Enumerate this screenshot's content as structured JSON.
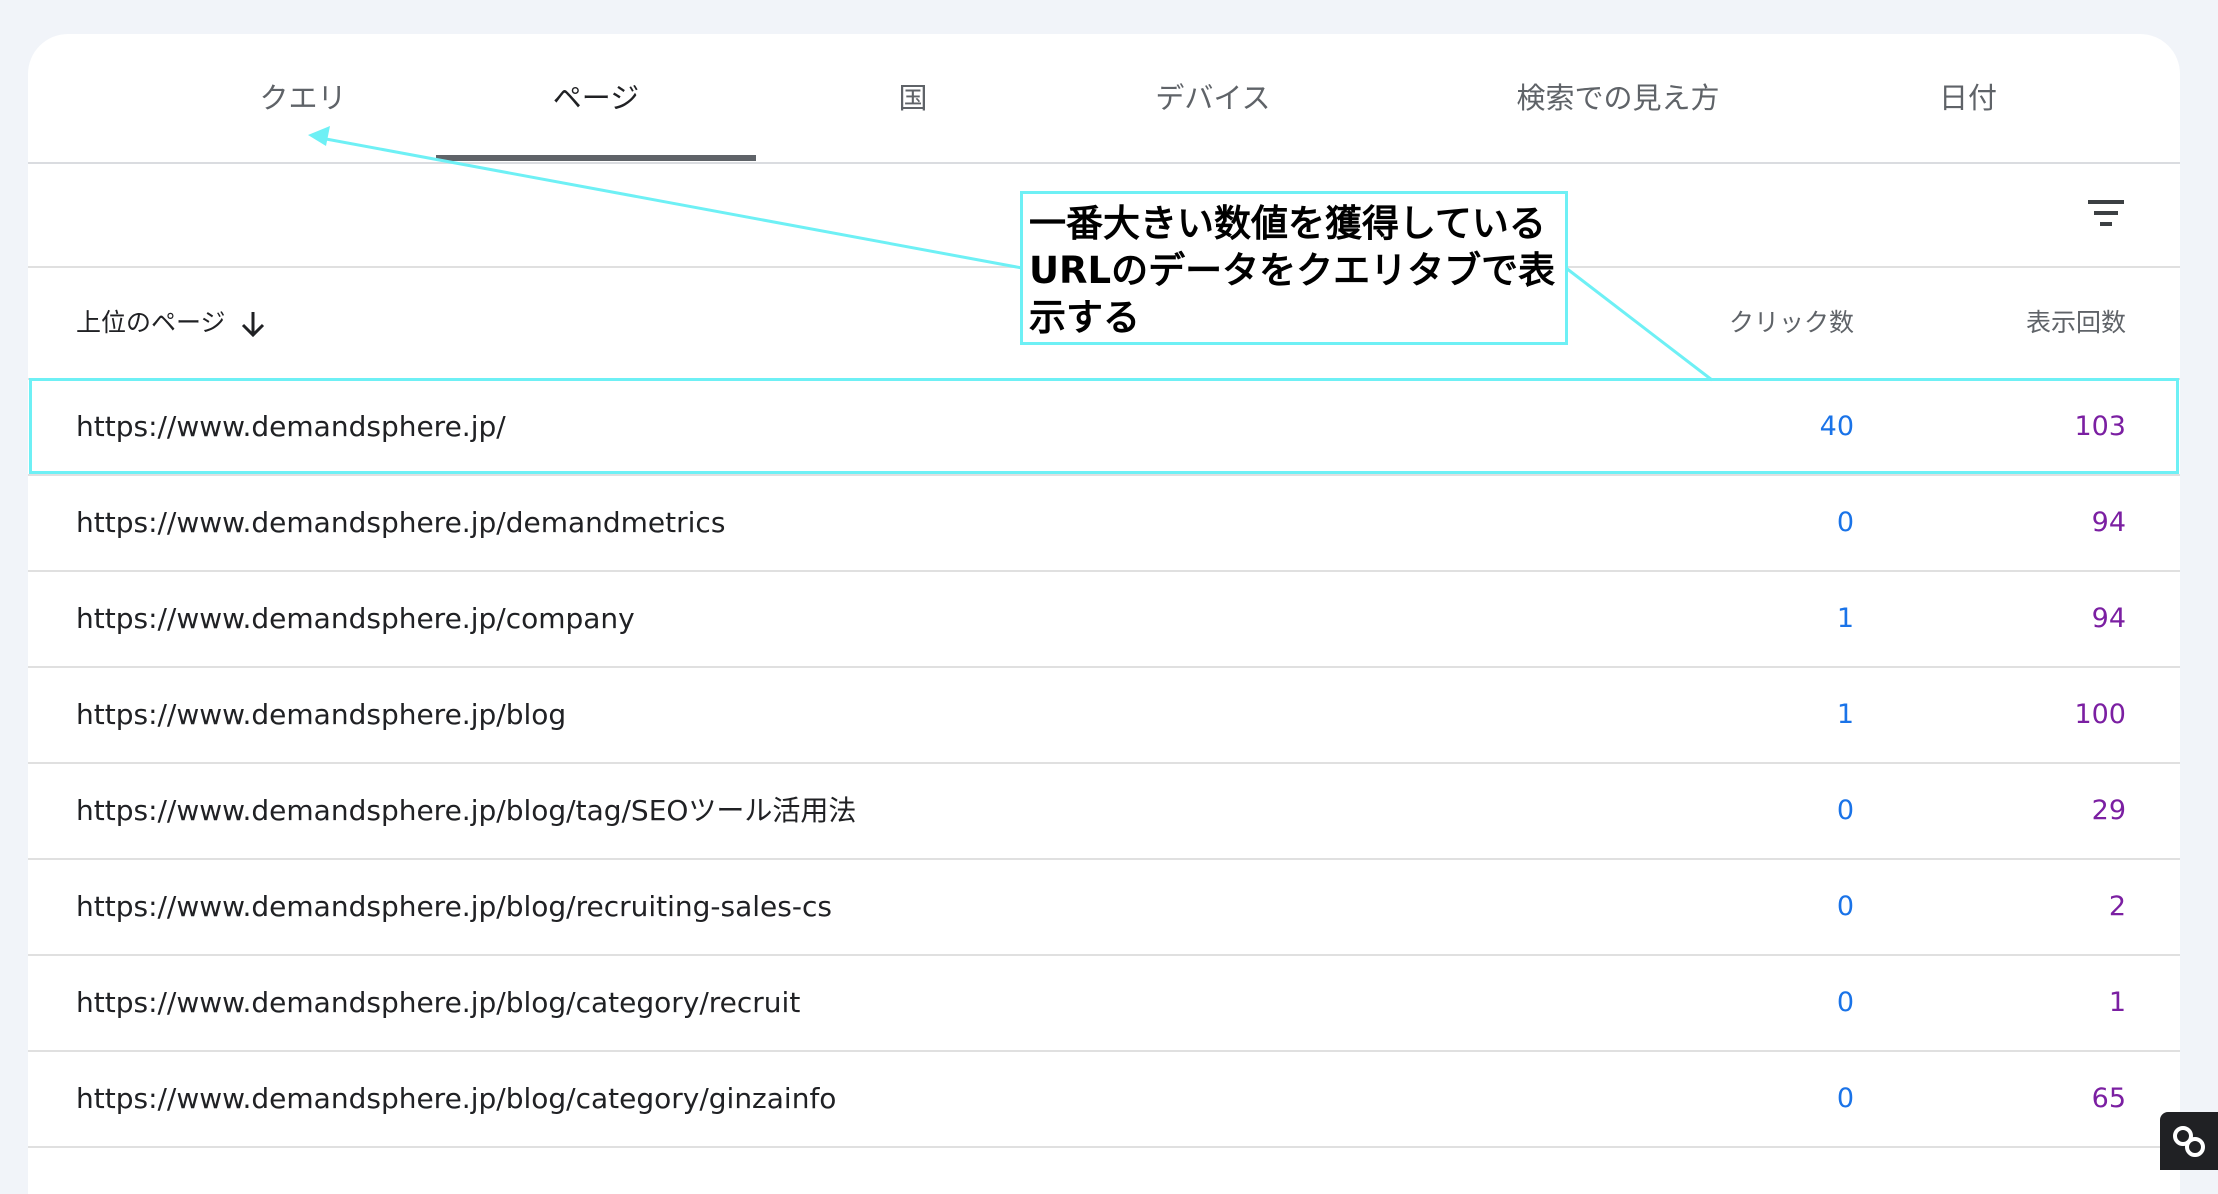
{
  "tabs": [
    {
      "label": "クエリ"
    },
    {
      "label": "ページ"
    },
    {
      "label": "国"
    },
    {
      "label": "デバイス"
    },
    {
      "label": "検索での見え方"
    },
    {
      "label": "日付"
    }
  ],
  "active_tab": "ページ",
  "table": {
    "header": {
      "page": "上位のページ",
      "clicks": "クリック数",
      "impressions": "表示回数"
    },
    "rows": [
      {
        "url": "https://www.demandsphere.jp/",
        "clicks": "40",
        "impressions": "103"
      },
      {
        "url": "https://www.demandsphere.jp/demandmetrics",
        "clicks": "0",
        "impressions": "94"
      },
      {
        "url": "https://www.demandsphere.jp/company",
        "clicks": "1",
        "impressions": "94"
      },
      {
        "url": "https://www.demandsphere.jp/blog",
        "clicks": "1",
        "impressions": "100"
      },
      {
        "url": "https://www.demandsphere.jp/blog/tag/SEOツール活用法",
        "clicks": "0",
        "impressions": "29"
      },
      {
        "url": "https://www.demandsphere.jp/blog/recruiting-sales-cs",
        "clicks": "0",
        "impressions": "2"
      },
      {
        "url": "https://www.demandsphere.jp/blog/category/recruit",
        "clicks": "0",
        "impressions": "1"
      },
      {
        "url": "https://www.demandsphere.jp/blog/category/ginzainfo",
        "clicks": "0",
        "impressions": "65"
      }
    ]
  },
  "annotation": {
    "text": "一番大きい数値を獲得しているURLのデータをクエリタブで表示する"
  },
  "colors": {
    "clicks": "#1a73e8",
    "impressions": "#7b1fa2",
    "annotation": "#6ef0f5"
  },
  "icons": {
    "filter": "filter-icon",
    "sort": "arrow-down-icon",
    "corner": "link-icon"
  }
}
